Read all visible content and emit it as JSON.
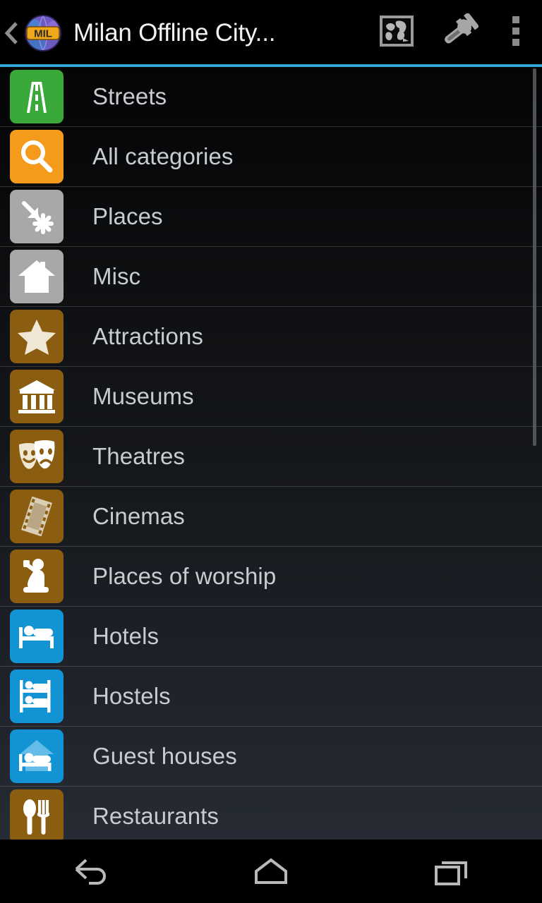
{
  "app": {
    "title": "Milan Offline City...",
    "logo_text": "MIL",
    "accent_color": "#33b5e5"
  },
  "actionbar": {
    "back_label": "Back",
    "logo_name": "app-logo-globe-mil",
    "actions": [
      {
        "name": "map-icon",
        "label": "Map"
      },
      {
        "name": "wrench-icon",
        "label": "Tools"
      },
      {
        "name": "overflow-menu-icon",
        "label": "More options"
      }
    ]
  },
  "list": {
    "items": [
      {
        "label": "Streets",
        "icon": "road-icon",
        "color": "#3aa93a"
      },
      {
        "label": "All categories",
        "icon": "magnifier-icon",
        "color": "#f59b1c"
      },
      {
        "label": "Places",
        "icon": "place-arrow-icon",
        "color": "#a8a8a8"
      },
      {
        "label": "Misc",
        "icon": "house-icon",
        "color": "#a8a8a8"
      },
      {
        "label": "Attractions",
        "icon": "star-icon",
        "color": "#8a5d10"
      },
      {
        "label": "Museums",
        "icon": "museum-icon",
        "color": "#8a5d10"
      },
      {
        "label": "Theatres",
        "icon": "theatre-masks-icon",
        "color": "#8a5d10"
      },
      {
        "label": "Cinemas",
        "icon": "film-strip-icon",
        "color": "#8a5d10"
      },
      {
        "label": "Places of worship",
        "icon": "praying-icon",
        "color": "#8a5d10"
      },
      {
        "label": "Hotels",
        "icon": "bed-icon",
        "color": "#1193d4"
      },
      {
        "label": "Hostels",
        "icon": "bunk-bed-icon",
        "color": "#1193d4"
      },
      {
        "label": "Guest houses",
        "icon": "guesthouse-icon",
        "color": "#1193d4"
      },
      {
        "label": "Restaurants",
        "icon": "cutlery-icon",
        "color": "#8a5d10"
      }
    ]
  },
  "navbar": {
    "buttons": [
      {
        "name": "nav-back-icon",
        "label": "Back"
      },
      {
        "name": "nav-home-icon",
        "label": "Home"
      },
      {
        "name": "nav-recents-icon",
        "label": "Recents"
      }
    ]
  }
}
